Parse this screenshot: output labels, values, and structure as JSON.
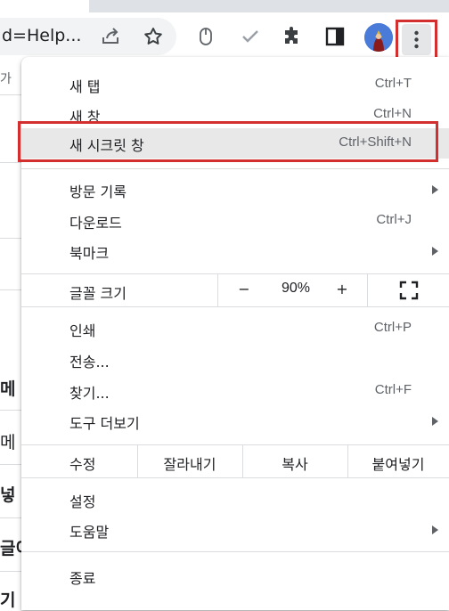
{
  "toolbar": {
    "url_text": "d=Help...",
    "icons": [
      "share-icon",
      "star-icon",
      "mouse-icon",
      "check-icon",
      "extensions-puzzle-icon",
      "side-panel-icon",
      "profile-avatar",
      "more-vert-icon"
    ]
  },
  "page": {
    "left_peeks": [
      "가 ",
      "메",
      "메",
      "넣",
      "글이",
      "기"
    ]
  },
  "menu": {
    "new_tab": {
      "label": "새 탭",
      "shortcut": "Ctrl+T"
    },
    "new_window": {
      "label": "새 창",
      "shortcut": "Ctrl+N"
    },
    "new_incognito": {
      "label": "새 시크릿 창",
      "shortcut": "Ctrl+Shift+N"
    },
    "history": {
      "label": "방문 기록"
    },
    "downloads": {
      "label": "다운로드",
      "shortcut": "Ctrl+J"
    },
    "bookmarks": {
      "label": "북마크"
    },
    "zoom": {
      "label": "글꼴 크기",
      "minus": "−",
      "value": "90%",
      "plus": "+"
    },
    "print": {
      "label": "인쇄",
      "shortcut": "Ctrl+P"
    },
    "cast": {
      "label": "전송..."
    },
    "find": {
      "label": "찾기...",
      "shortcut": "Ctrl+F"
    },
    "more_tools": {
      "label": "도구 더보기"
    },
    "edit": {
      "label": "수정",
      "cut": "잘라내기",
      "copy": "복사",
      "paste": "붙여넣기"
    },
    "settings": {
      "label": "설정"
    },
    "help": {
      "label": "도움말"
    },
    "exit": {
      "label": "종료"
    }
  },
  "colors": {
    "highlight_border": "#d32f2f",
    "hover_bg": "#e8e8e8",
    "text": "#202124",
    "secondary_text": "#5f6368"
  }
}
